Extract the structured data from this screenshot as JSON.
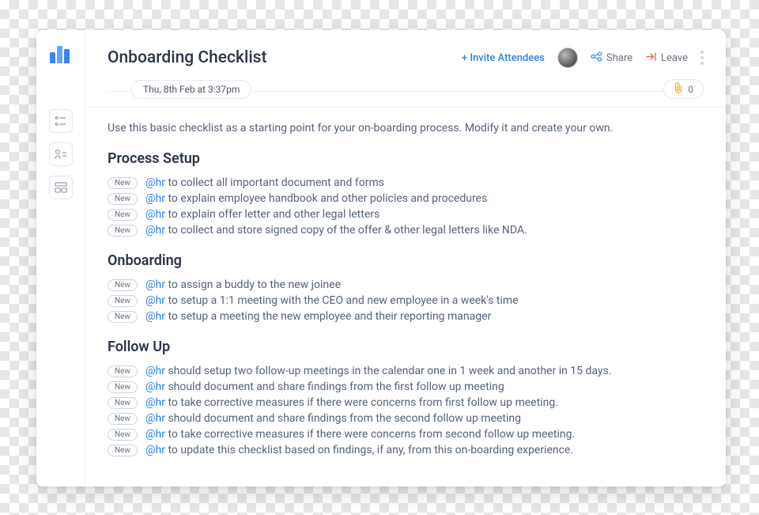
{
  "header": {
    "title": "Onboarding Checklist",
    "invite": "+ Invite Attendees",
    "share": "Share",
    "leave": "Leave"
  },
  "subheader": {
    "date": "Thu, 8th Feb at 3:37pm",
    "attachments": "0"
  },
  "intro": "Use this basic checklist as a starting point for your on-boarding process. Modify it and create your own.",
  "mention": "@hr",
  "badge": "New",
  "sections": [
    {
      "title": "Process Setup",
      "items": [
        "to collect all important document and forms",
        "to explain employee handbook and other policies and procedures",
        "to explain offer letter and other legal letters",
        "to collect and store signed copy of the offer & other legal letters like NDA."
      ]
    },
    {
      "title": "Onboarding",
      "items": [
        "to assign a buddy to the new joinee",
        "to setup a 1:1 meeting with the CEO and new employee in a week's time",
        "to setup a meeting the new employee and their reporting manager"
      ]
    },
    {
      "title": "Follow Up",
      "items": [
        "should setup two follow-up meetings in the calendar one in 1 week and another in 15 days.",
        "should document and share findings from the first follow up meeting",
        "to take corrective measures if there were concerns from first follow up meeting.",
        "should document and share findings from the second follow up meeting",
        "to take corrective measures if there were concerns from second follow up meeting.",
        "to update this checklist based on findings, if any, from this on-boarding experience."
      ]
    }
  ]
}
